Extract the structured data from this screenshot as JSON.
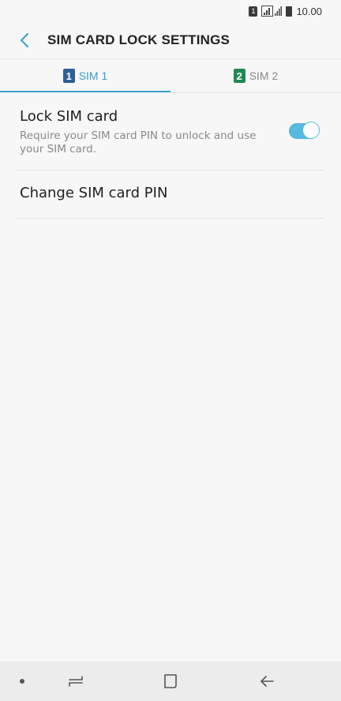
{
  "status_bar": {
    "sim_indicator": "1",
    "time": "10.00",
    "icons": [
      "sim-indicator-icon",
      "signal-icon",
      "battery-icon"
    ]
  },
  "header": {
    "back_icon": "chevron-left-icon",
    "title": "SIM CARD LOCK SETTINGS"
  },
  "tabs": [
    {
      "badge": "1",
      "label": "SIM 1",
      "active": true,
      "badge_color": "#2e5f96"
    },
    {
      "badge": "2",
      "label": "SIM 2",
      "active": false,
      "badge_color": "#1d8a54"
    }
  ],
  "settings": {
    "lock_sim": {
      "title": "Lock SIM card",
      "description": "Require your SIM card PIN to unlock and use your SIM card.",
      "enabled": true
    },
    "change_pin": {
      "title": "Change SIM card PIN"
    }
  },
  "nav_bar": {
    "icons": [
      "dot-icon",
      "recent-apps-icon",
      "home-icon",
      "back-arrow-icon"
    ]
  },
  "colors": {
    "accent": "#3a9fc4",
    "toggle_on": "#57b8e0",
    "background": "#f7f7f7"
  }
}
